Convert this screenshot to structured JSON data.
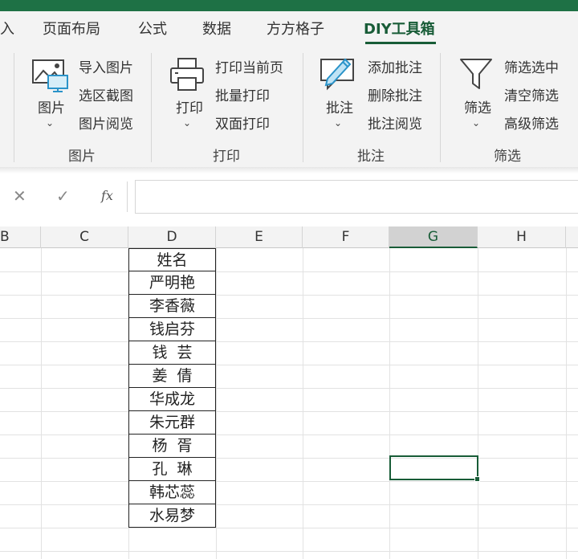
{
  "tabs": [
    {
      "label": "入"
    },
    {
      "label": "页面布局"
    },
    {
      "label": "公式"
    },
    {
      "label": "数据"
    },
    {
      "label": "方方格子"
    },
    {
      "label": "DIY工具箱",
      "active": true
    }
  ],
  "ribbon": {
    "groups": [
      {
        "name": "图片",
        "big_button": "图片",
        "commands": [
          "导入图片",
          "选区截图",
          "图片阅览"
        ]
      },
      {
        "name": "打印",
        "big_button": "打印",
        "commands": [
          "打印当前页",
          "批量打印",
          "双面打印"
        ]
      },
      {
        "name": "批注",
        "big_button": "批注",
        "commands": [
          "添加批注",
          "删除批注",
          "批注阅览"
        ]
      },
      {
        "name": "筛选",
        "big_button": "筛选",
        "commands": [
          "筛选选中",
          "清空筛选",
          "高级筛选"
        ]
      }
    ],
    "chevron": "⌄"
  },
  "formula_bar": {
    "cancel_symbol": "✕",
    "enter_symbol": "✓",
    "fx_label": "fx",
    "value": ""
  },
  "sheet": {
    "columns": [
      "B",
      "C",
      "D",
      "E",
      "F",
      "G",
      "H"
    ],
    "selected_column": "G",
    "name_list": [
      "姓名",
      "严明艳",
      "李香薇",
      "钱启芬",
      "钱  芸",
      "姜  倩",
      "华成龙",
      "朱元群",
      "杨  胥",
      "孔  琳",
      "韩芯蕊",
      "水易梦"
    ],
    "active_cell": "G10"
  },
  "colors": {
    "accent": "#185c37",
    "title_bar": "#1e7145",
    "ribbon_bg": "#f3f3f3"
  }
}
